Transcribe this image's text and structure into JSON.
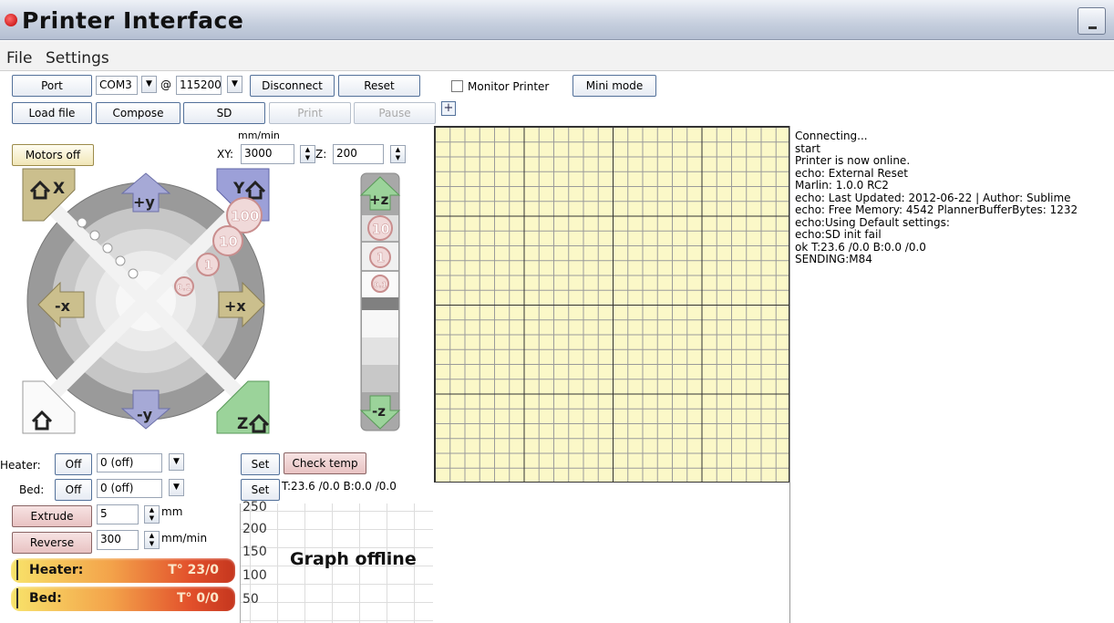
{
  "window": {
    "title": "Printer Interface"
  },
  "menu": {
    "file": "File",
    "settings": "Settings"
  },
  "connection": {
    "port_button": "Port",
    "port_value": "COM3",
    "at": "@",
    "baud_value": "115200",
    "disconnect": "Disconnect",
    "reset": "Reset",
    "monitor_label": "Monitor Printer",
    "monitor_checked": false,
    "mini_mode": "Mini mode"
  },
  "toolbar": {
    "load_file": "Load file",
    "compose": "Compose",
    "sd": "SD",
    "print": "Print",
    "pause": "Pause",
    "add": "+"
  },
  "motion": {
    "motors_off": "Motors off",
    "feed_unit": "mm/min",
    "xy_label": "XY:",
    "xy_value": "3000",
    "z_label": "Z:",
    "z_value": "200"
  },
  "xy_jog": {
    "home_x": "X",
    "home_y": "Y",
    "home_z": "Z",
    "plus_y": "+y",
    "minus_y": "-y",
    "plus_x": "+x",
    "minus_x": "-x",
    "step_100": "100",
    "step_10": "10",
    "step_1": "1",
    "step_01": "0.1"
  },
  "z_jog": {
    "plus_z": "+z",
    "minus_z": "-z",
    "step_10": "10",
    "step_1": "1",
    "step_01": "0.1"
  },
  "temperature": {
    "heater_label": "Heater:",
    "bed_label": "Bed:",
    "heater_off": "Off",
    "bed_off": "Off",
    "heater_value": "0 (off)",
    "bed_value": "0 (off)",
    "set": "Set",
    "check_temp": "Check temp",
    "readout": "T:23.6 /0.0 B:0.0 /0.0"
  },
  "extrude": {
    "extrude": "Extrude",
    "reverse": "Reverse",
    "length": "5",
    "length_unit": "mm",
    "speed": "300",
    "speed_unit": "mm/min"
  },
  "graph": {
    "status": "Graph offline",
    "ticks": [
      "250",
      "200",
      "150",
      "100",
      "50"
    ]
  },
  "temp_bars": {
    "heater_label": "Heater:",
    "heater_value": "T° 23/0",
    "bed_label": "Bed:",
    "bed_value": "T° 0/0"
  },
  "log": [
    "Connecting...",
    "start",
    "Printer is now online.",
    "echo: External Reset",
    "Marlin: 1.0.0 RC2",
    "echo: Last Updated: 2012-06-22 | Author: Sublime",
    "echo: Free Memory: 4542  PlannerBufferBytes: 1232",
    "echo:Using Default settings:",
    "echo:SD init fail",
    "ok T:23.6 /0.0 B:0.0 /0.0",
    "SENDING:M84"
  ]
}
